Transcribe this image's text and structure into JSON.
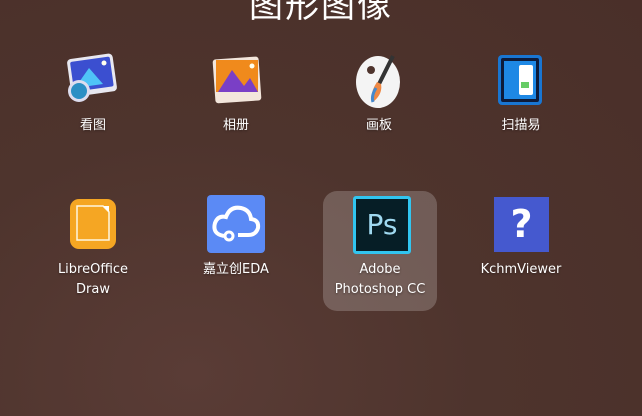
{
  "category_title": "图形图像",
  "apps": [
    {
      "name": "看图",
      "icon": "image-viewer-icon"
    },
    {
      "name": "相册",
      "icon": "photo-album-icon"
    },
    {
      "name": "画板",
      "icon": "paint-palette-icon"
    },
    {
      "name": "扫描易",
      "icon": "scanner-icon"
    },
    {
      "name": "LibreOffice",
      "name2": "Draw",
      "icon": "libreoffice-draw-icon"
    },
    {
      "name": "嘉立创EDA",
      "icon": "cloud-eda-icon"
    },
    {
      "name": "Adobe",
      "name2": "Photoshop CC",
      "icon": "photoshop-icon",
      "ps_text": "Ps"
    },
    {
      "name": "KchmViewer",
      "icon": "help-question-icon",
      "q_text": "?"
    }
  ]
}
